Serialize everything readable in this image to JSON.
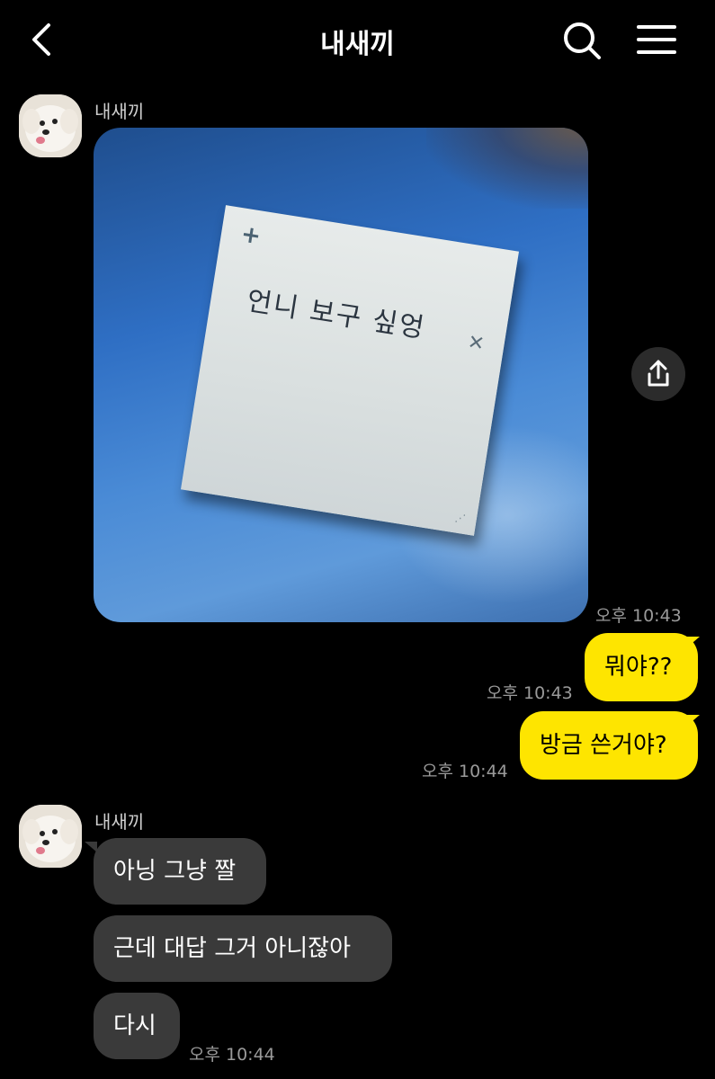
{
  "header": {
    "title": "내새끼",
    "back_icon": "chevron-left-icon",
    "search_icon": "search-icon",
    "menu_icon": "hamburger-menu-icon"
  },
  "colors": {
    "background": "#000000",
    "my_bubble": "#fee500",
    "their_bubble": "#3a3a3a",
    "timestamp": "#9a9a9a"
  },
  "messages": [
    {
      "sender": "내새끼",
      "type": "photo",
      "photo_text": "언니 보구 싶엉",
      "time": "오후 10:43"
    },
    {
      "sender": "me",
      "text": "뭐야??",
      "time": "오후 10:43"
    },
    {
      "sender": "me",
      "text": "방금 쓴거야?",
      "time": "오후 10:44"
    },
    {
      "sender": "내새끼",
      "text": "아닝 그냥 짤"
    },
    {
      "sender": "내새끼",
      "text": "근데 대답 그거 아니잖아"
    },
    {
      "sender": "내새끼",
      "text": "다시",
      "time": "오후 10:44"
    }
  ]
}
